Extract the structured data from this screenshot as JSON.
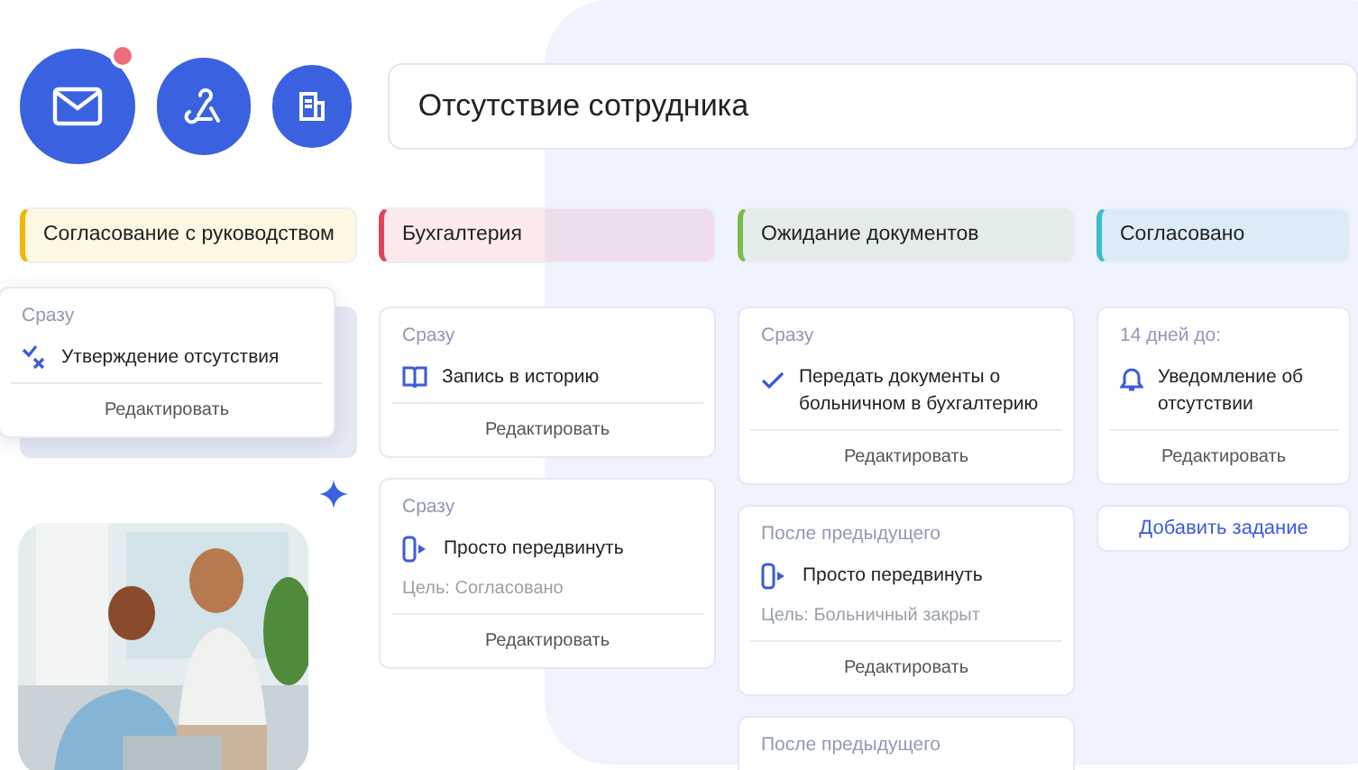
{
  "title_field": {
    "value": "Отсутствие сотрудника"
  },
  "mail_button": {
    "notification": true
  },
  "columns": [
    {
      "title": "Согласование с руководством",
      "color": "#f2b705",
      "raised": true,
      "cards": [
        {
          "kind": "approval",
          "timing": "Сразу",
          "task": "Утверждение отсутствия",
          "action": "Редактировать"
        }
      ]
    },
    {
      "title": "Бухгалтерия",
      "color": "#e0435a",
      "raised": false,
      "cards": [
        {
          "kind": "history",
          "timing": "Сразу",
          "task": "Запись в историю",
          "action": "Редактировать"
        },
        {
          "kind": "move",
          "timing": "Сразу",
          "task": "Просто передвинуть",
          "target": "Цель: Согласовано",
          "action": "Редактировать"
        }
      ]
    },
    {
      "title": "Ожидание документов",
      "color": "#7cbd4a",
      "raised": false,
      "cards": [
        {
          "kind": "check",
          "timing": "Сразу",
          "task": "Передать документы о больничном в бухгалтерию",
          "action": "Редактировать"
        },
        {
          "kind": "move",
          "timing": "После предыдущего",
          "task": "Просто передвинуть",
          "target": "Цель: Больничный закрыт",
          "action": "Редактировать"
        },
        {
          "kind": "partial",
          "timing": "После предыдущего"
        }
      ]
    },
    {
      "title": "Согласовано",
      "color": "#3bbfc9",
      "raised": false,
      "cards": [
        {
          "kind": "notify",
          "timing": "14 дней до:",
          "task": "Уведомление об отсутствии",
          "action": "Редактировать"
        },
        {
          "kind": "add",
          "label": "Добавить задание"
        }
      ]
    }
  ]
}
